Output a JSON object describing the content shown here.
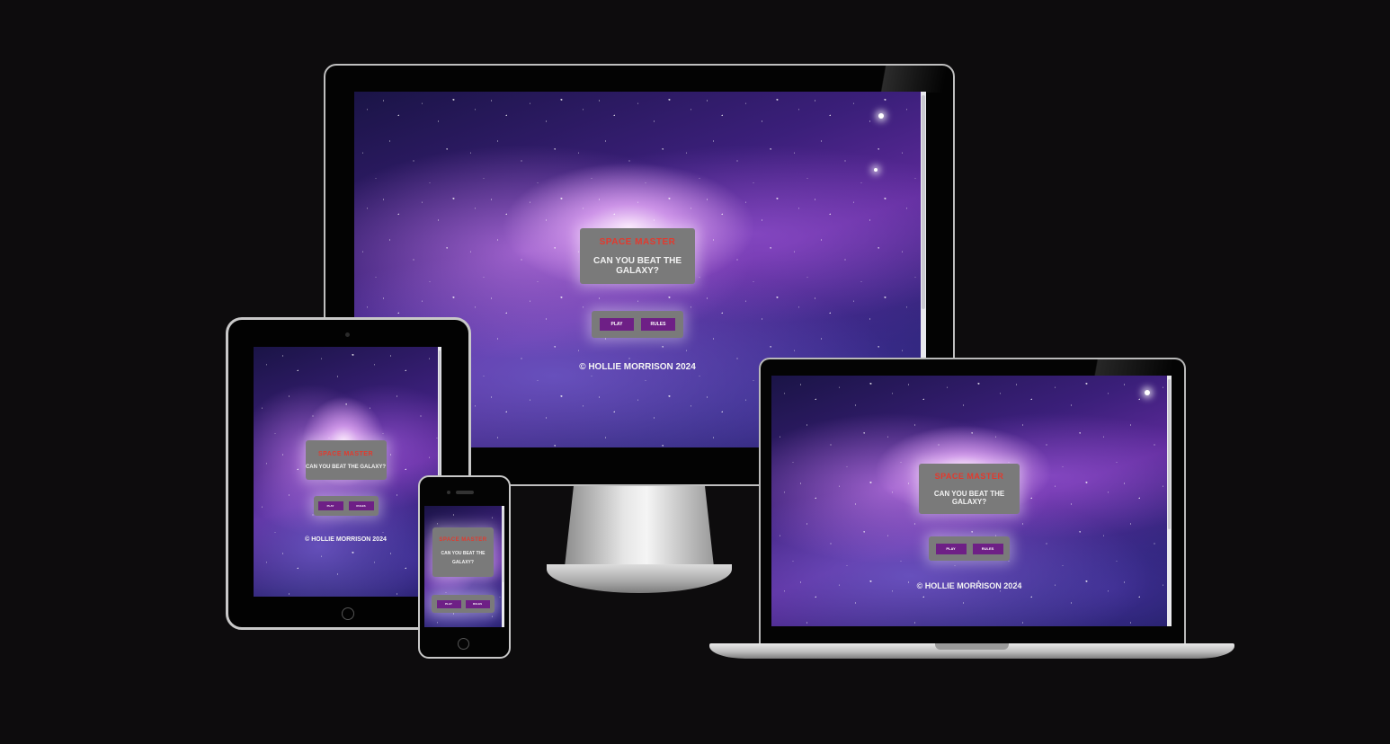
{
  "app": {
    "game_title": "SPACE MASTER",
    "tagline": "CAN YOU BEAT THE GALAXY?",
    "play_label": "PLAY",
    "rules_label": "RULES",
    "copyright": "© HOLLIE MORRISON 2024",
    "tagline_phone_line1": "CAN YOU BEAT THE",
    "tagline_phone_line2": "GALAXY?"
  },
  "colors": {
    "page_background": "#0d0c0d",
    "panel_gray": "#7a7a7a",
    "title_red": "#e23a2e",
    "button_purple": "#6e1f86",
    "text_white": "#f2f2f2"
  },
  "devices": [
    "desktop-monitor",
    "tablet",
    "smartphone",
    "laptop"
  ]
}
